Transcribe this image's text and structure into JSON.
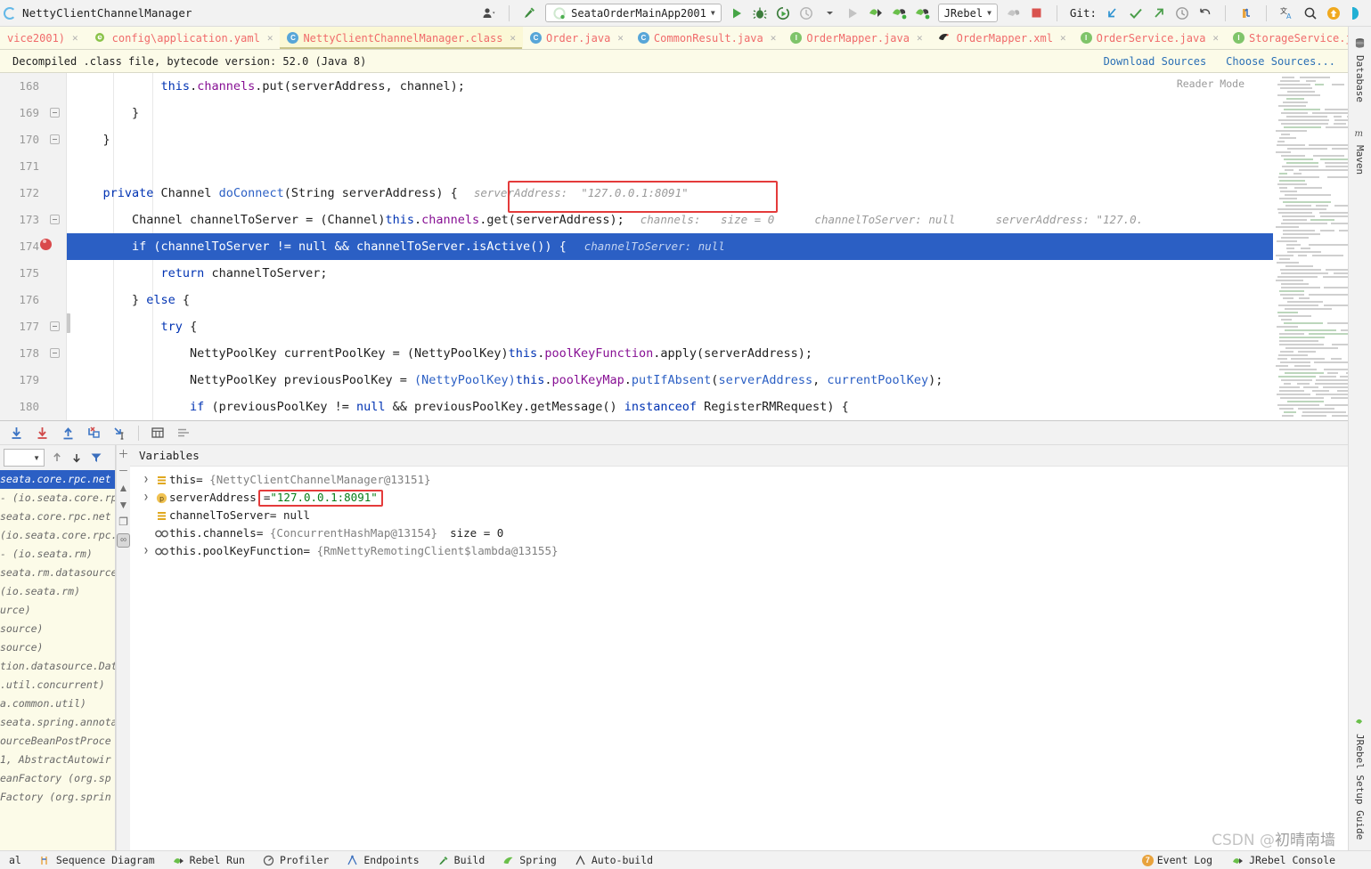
{
  "window": {
    "title": "NettyClientChannelManager",
    "run_config": "SeataOrderMainApp2001",
    "plugin_config": "JRebel",
    "git_label": "Git:"
  },
  "tabs": [
    {
      "label": "vice2001)",
      "icon": "",
      "active": false
    },
    {
      "label": "config\\application.yaml",
      "icon": "yaml-icon",
      "active": false
    },
    {
      "label": "NettyClientChannelManager.class",
      "icon": "class-icon",
      "active": true
    },
    {
      "label": "Order.java",
      "icon": "class-icon",
      "active": false
    },
    {
      "label": "CommonResult.java",
      "icon": "class-icon",
      "active": false
    },
    {
      "label": "OrderMapper.java",
      "icon": "interface-icon",
      "active": false
    },
    {
      "label": "OrderMapper.xml",
      "icon": "mybatis-icon",
      "active": false
    },
    {
      "label": "OrderService.java",
      "icon": "interface-icon",
      "active": false
    },
    {
      "label": "StorageService.j",
      "icon": "interface-icon",
      "active": false
    }
  ],
  "notice": {
    "text": "Decompiled .class file, bytecode version: 52.0 (Java 8)",
    "download_sources": "Download Sources",
    "choose_sources": "Choose Sources..."
  },
  "editor": {
    "reader_mode": "Reader Mode",
    "lines": [
      {
        "no": "168",
        "indent": 0,
        "fold": false,
        "breakpoint": false,
        "highlight": false,
        "html": "            <span class=\"this\">this</span>.<span class=\"fld\">channels</span>.put(serverAddress, channel);",
        "hint": ""
      },
      {
        "no": "169",
        "indent": 0,
        "fold": true,
        "breakpoint": false,
        "highlight": false,
        "html": "        }",
        "hint": ""
      },
      {
        "no": "170",
        "indent": 0,
        "fold": true,
        "breakpoint": false,
        "highlight": false,
        "html": "    }",
        "hint": ""
      },
      {
        "no": "171",
        "indent": 0,
        "fold": false,
        "breakpoint": false,
        "highlight": false,
        "html": "",
        "hint": ""
      },
      {
        "no": "172",
        "indent": 0,
        "fold": true,
        "breakpoint": false,
        "highlight": false,
        "html": "    <span class=\"kw\">private</span> Channel <span class=\"mth\">doConnect</span>(String serverAddress) {",
        "hint": "serverAddress:  \"127.0.0.1:8091\""
      },
      {
        "no": "173",
        "indent": 0,
        "fold": false,
        "breakpoint": false,
        "highlight": false,
        "html": "        Channel channelToServer = (Channel)<span class=\"this\">this</span>.<span class=\"fld\">channels</span>.get(serverAddress);",
        "hint": "channels:   size = 0      channelToServer: null      serverAddress: \"127.0."
      },
      {
        "no": "174",
        "indent": 0,
        "fold": false,
        "breakpoint": true,
        "highlight": true,
        "html": "        <span class=\"kw\">if</span> (channelToServer != <span class=\"kw\">null</span> &amp;&amp; channelToServer.isActive()) {",
        "hint": "channelToServer: null"
      },
      {
        "no": "175",
        "indent": 0,
        "fold": false,
        "breakpoint": false,
        "highlight": false,
        "html": "            <span class=\"kw\">return</span> channelToServer;",
        "hint": ""
      },
      {
        "no": "176",
        "indent": 0,
        "fold": true,
        "breakpoint": false,
        "highlight": false,
        "html": "        } <span class=\"kw\">else</span> {",
        "hint": ""
      },
      {
        "no": "177",
        "indent": 0,
        "fold": true,
        "breakpoint": false,
        "highlight": false,
        "html": "            <span class=\"kw\">try</span> {",
        "hint": ""
      },
      {
        "no": "178",
        "indent": 0,
        "fold": false,
        "breakpoint": false,
        "highlight": false,
        "html": "                NettyPoolKey currentPoolKey = (NettyPoolKey)<span class=\"this\">this</span>.<span class=\"fld\">poolKeyFunction</span>.apply(serverAddress);",
        "hint": ""
      },
      {
        "no": "179",
        "indent": 0,
        "fold": false,
        "breakpoint": false,
        "highlight": false,
        "html": "                NettyPoolKey previousPoolKey = <span class=\"mth\">(NettyPoolKey)</span><span class=\"this\">this</span>.<span class=\"fld\">poolKeyMap</span>.<span class=\"mth\">putIfAbsent</span>(<span class=\"mth\">serverAddress</span>, <span class=\"mth\">currentPoolKey</span>);",
        "hint": ""
      },
      {
        "no": "180",
        "indent": 0,
        "fold": false,
        "breakpoint": false,
        "highlight": false,
        "html": "                <span class=\"kw\">if</span> (previousPoolKey != <span class=\"kw\">null</span> &amp;&amp; previousPoolKey.getMessage() <span class=\"kw\">instanceof</span> RegisterRMRequest) {",
        "hint": ""
      }
    ],
    "highlight_color": "#2b5fc4",
    "annotation_color": "#e43b3b"
  },
  "debugger": {
    "variables_title": "Variables",
    "frames": [
      {
        "text": "seata.core.rpc.net",
        "selected": true
      },
      {
        "text": "- (io.seata.core.rp",
        "selected": false
      },
      {
        "text": "seata.core.rpc.net",
        "selected": false
      },
      {
        "text": "(io.seata.core.rpc.",
        "selected": false
      },
      {
        "text": "- (io.seata.rm)",
        "selected": false
      },
      {
        "text": "seata.rm.datasource",
        "selected": false
      },
      {
        "text": "(io.seata.rm)",
        "selected": false
      },
      {
        "text": "urce)",
        "selected": false
      },
      {
        "text": "source)",
        "selected": false
      },
      {
        "text": "source)",
        "selected": false
      },
      {
        "text": "tion.datasource.Dat",
        "selected": false
      },
      {
        "text": ".util.concurrent)",
        "selected": false
      },
      {
        "text": "a.common.util)",
        "selected": false
      },
      {
        "text": "seata.spring.annota",
        "selected": false
      },
      {
        "text": "ourceBeanPostProce",
        "selected": false
      },
      {
        "text": "1, AbstractAutowir",
        "selected": false
      },
      {
        "text": "eanFactory (org.sp",
        "selected": false
      },
      {
        "text": "Factory (org.sprin",
        "selected": false
      }
    ],
    "variables": [
      {
        "expandable": true,
        "icon": "object-icon",
        "name": "this",
        "eq": "=",
        "value": "{NettyClientChannelManager@13151}",
        "value_kind": "obj",
        "extra": "",
        "boxed": false
      },
      {
        "expandable": true,
        "icon": "param-icon",
        "name": "serverAddress",
        "eq": "=",
        "value": "\"127.0.0.1:8091\"",
        "value_kind": "str",
        "extra": "",
        "boxed": true
      },
      {
        "expandable": false,
        "icon": "object-icon",
        "name": "channelToServer",
        "eq": "=",
        "value": "null",
        "value_kind": "null",
        "extra": "",
        "boxed": false
      },
      {
        "expandable": false,
        "icon": "field-icon",
        "name": "this.channels",
        "eq": "=",
        "value": "{ConcurrentHashMap@13154}",
        "value_kind": "obj",
        "extra": "size = 0",
        "boxed": false
      },
      {
        "expandable": true,
        "icon": "field-icon",
        "name": "this.poolKeyFunction",
        "eq": "=",
        "value": "{RmNettyRemotingClient$lambda@13155}",
        "value_kind": "obj",
        "extra": "",
        "boxed": false
      }
    ]
  },
  "right_rail": [
    {
      "label": "Database",
      "icon": "database-icon"
    },
    {
      "label": "Maven",
      "icon": "maven-icon"
    },
    {
      "label": "JRebel Setup Guide",
      "icon": "jrebel-icon"
    }
  ],
  "statusbar": {
    "left": [
      {
        "label": "al",
        "icon": ""
      },
      {
        "label": "Sequence Diagram",
        "icon": "sequence-diagram-icon"
      },
      {
        "label": "Rebel Run",
        "icon": "jrebel-icon"
      },
      {
        "label": "Profiler",
        "icon": "profiler-icon"
      },
      {
        "label": "Endpoints",
        "icon": "endpoints-icon"
      },
      {
        "label": "Build",
        "icon": "build-icon"
      },
      {
        "label": "Spring",
        "icon": "spring-icon"
      },
      {
        "label": "Auto-build",
        "icon": "auto-build-icon"
      }
    ],
    "right": [
      {
        "label": "Event Log",
        "icon": "event-log-icon",
        "badge": "7"
      },
      {
        "label": "JRebel Console",
        "icon": "jrebel-icon",
        "badge": ""
      }
    ]
  },
  "watermark": {
    "prefix": "CSDN @",
    "name": "初晴南墙"
  }
}
